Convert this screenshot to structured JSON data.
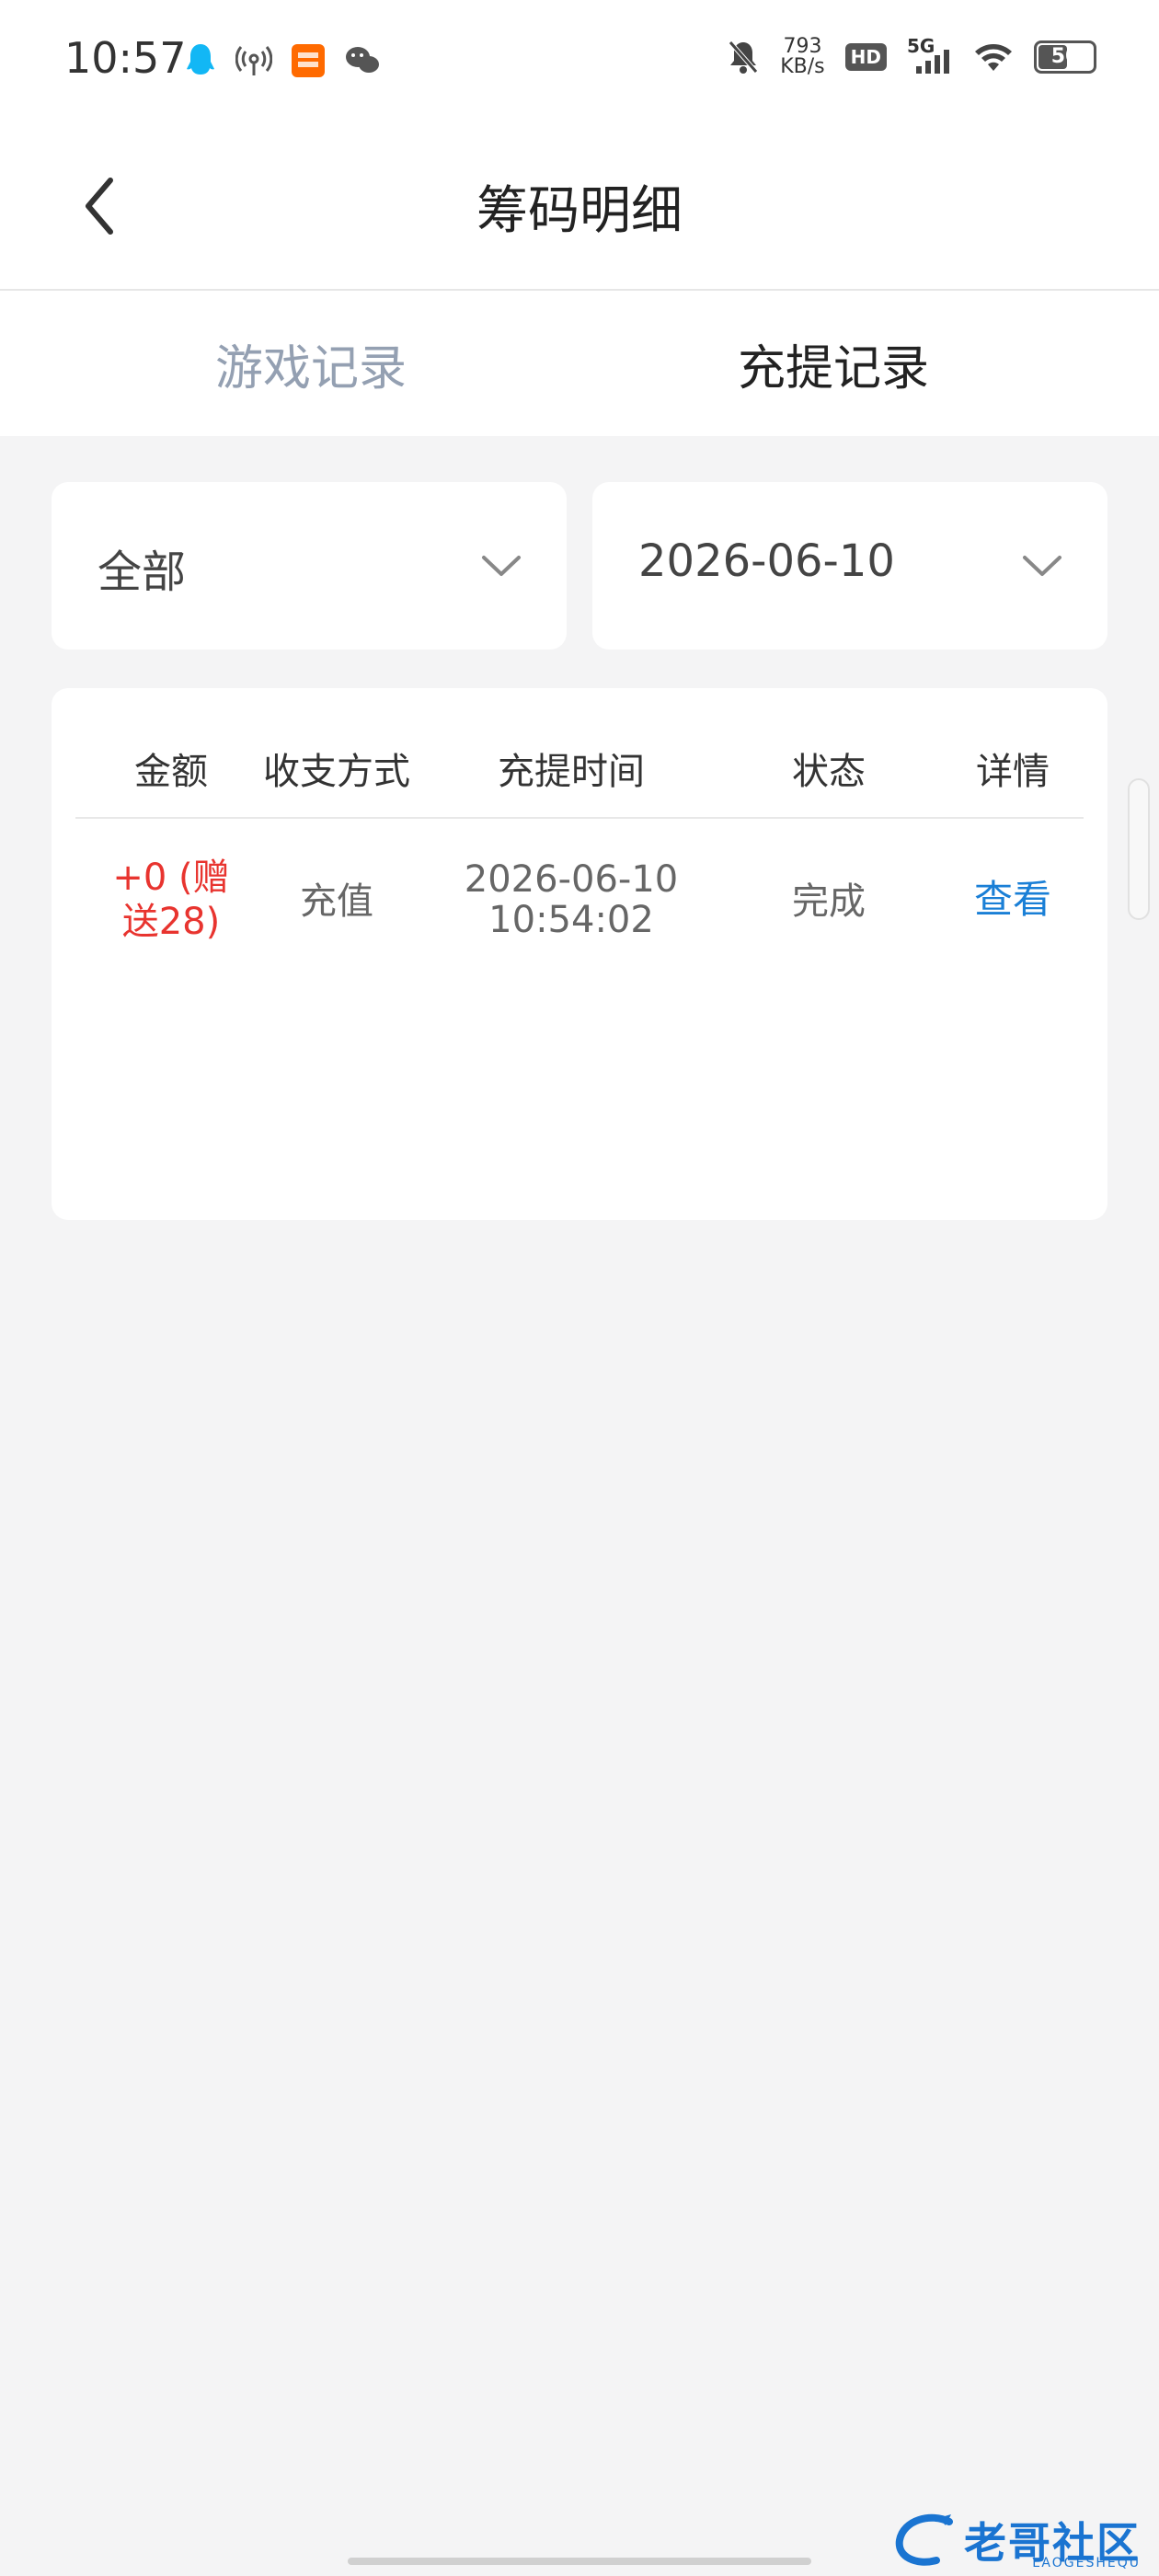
{
  "status_bar": {
    "time": "10:57",
    "net_speed_value": "793",
    "net_speed_unit": "KB/s",
    "hd_label": "HD",
    "signal_label": "5G",
    "battery_level": "50"
  },
  "nav": {
    "title": "筹码明细"
  },
  "tabs": [
    {
      "label": "游戏记录",
      "active": false
    },
    {
      "label": "充提记录",
      "active": true
    }
  ],
  "filters": {
    "type_value": "全部",
    "date_value": "2026-06-10"
  },
  "table": {
    "headers": [
      "金额",
      "收支方式",
      "充提时间",
      "状态",
      "详情"
    ],
    "rows": [
      {
        "amount_line1": "+0 (赠",
        "amount_line2": "送28)",
        "method": "充值",
        "time_line1": "2026-06-10",
        "time_line2": "10:54:02",
        "status": "完成",
        "detail": "查看"
      }
    ]
  },
  "watermark": {
    "text": "老哥社区",
    "sub": "LAOGESHEQU"
  },
  "colors": {
    "accent_link": "#1a7fd6",
    "amount_red": "#e8342f",
    "tab_inactive": "#94a0b2",
    "background": "#f4f4f5"
  }
}
